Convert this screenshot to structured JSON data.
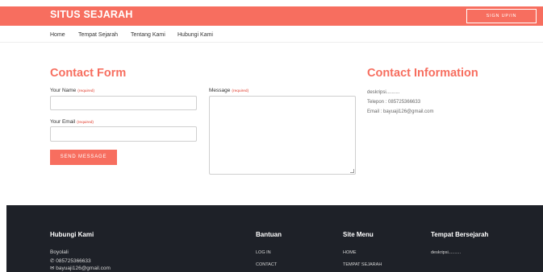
{
  "header": {
    "brand": "SITUS SEJARAH",
    "signup_label": "SIGN UP/IN"
  },
  "nav": {
    "items": [
      "Home",
      "Tempat Sejarah",
      "Tentang Kami",
      "Hubungi Kami"
    ]
  },
  "contact_form": {
    "title": "Contact Form",
    "name_label": "Your Name",
    "email_label": "Your Email",
    "message_label": "Message",
    "required_tag": "(required)",
    "send_label": "SEND MESSAGE"
  },
  "contact_info": {
    "title": "Contact Information",
    "description": "deskripsi..........",
    "phone": "Telepon : 085725366633",
    "email": "Email : bayuaji126@gmail.com"
  },
  "footer": {
    "hubungi": {
      "title": "Hubungi Kami",
      "city": "Boyolali",
      "phone": "085725366633",
      "email": "bayuaji126@gmail.com"
    },
    "bantuan": {
      "title": "Bantuan",
      "links": [
        "LOG IN",
        "CONTACT"
      ]
    },
    "site_menu": {
      "title": "Site Menu",
      "links": [
        "HOME",
        "TEMPAT SEJARAH"
      ]
    },
    "tempat": {
      "title": "Tempat Bersejarah",
      "description": "deskripsi.........."
    }
  },
  "colors": {
    "accent": "#f76e5f",
    "footer_bg": "#1e2128"
  }
}
